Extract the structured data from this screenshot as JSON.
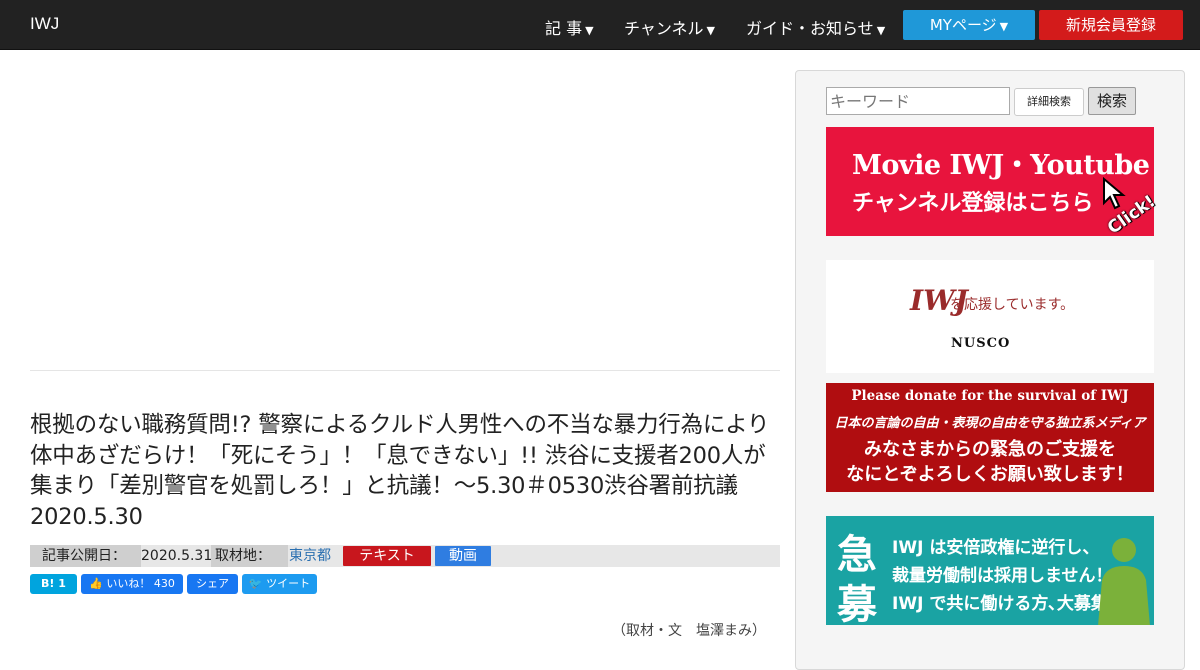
{
  "nav": {
    "brand": "IWJ",
    "items": [
      {
        "label": "記 事"
      },
      {
        "label": "チャンネル"
      },
      {
        "label": "ガイド・お知らせ"
      }
    ],
    "mypage_label": "MYページ",
    "register_label": "新規会員登録"
  },
  "article": {
    "title": "根拠のない職務質問!? 警察によるクルド人男性への不当な暴力行為により体中あざだらけ！「死にそう」！「息できない」!! 渋谷に支援者200人が集まり「差別警官を処罰しろ！」と抗議！～5.30＃0530渋谷署前抗議 2020.5.30",
    "published_label": "記事公開日：",
    "published_date": "2020.5.31",
    "location_label": "取材地：",
    "location": "東京都",
    "tags": [
      "テキスト",
      "動画"
    ],
    "share": {
      "hatena": "B! 1",
      "like": "いいね！ 430",
      "share": "シェア",
      "tweet": "ツイート"
    },
    "cut_text": "（取材・文　塩澤まみ）"
  },
  "sidebar": {
    "search_placeholder": "キーワード",
    "advanced_label": "詳細検索",
    "search_label": "検索",
    "banner_youtube": {
      "line1": "Movie IWJ・Youtube",
      "line2": "チャンネル登録はこちら",
      "click": "Click!"
    },
    "banner_nusco": {
      "iwj": "IWJ",
      "support": "を応援しています。",
      "company": "NUSCO"
    },
    "banner_donate": {
      "line1": "Please donate for the survival of IWJ",
      "line2": "日本の言論の自由・表現の自由を守る独立系メディア",
      "line3": "みなさまからの緊急のご支援を",
      "line4": "なにとぞよろしくお願い致します！"
    },
    "banner_recruit": {
      "kanji1": "急",
      "kanji2": "募",
      "line1": "IWJ は安倍政権に逆行し、",
      "line2": "裁量労働制は採用しません！",
      "line3": "IWJ で共に働ける方､大募集中！"
    }
  },
  "colors": {
    "nav_bg": "#222222",
    "mypage": "#1f98d8",
    "register": "#d31b1b",
    "tag_text": "#c8161d",
    "tag_video": "#2f7de1",
    "youtube_banner": "#e8143d",
    "donate_banner": "#b00d10",
    "recruit_banner": "#1aa3a3"
  }
}
